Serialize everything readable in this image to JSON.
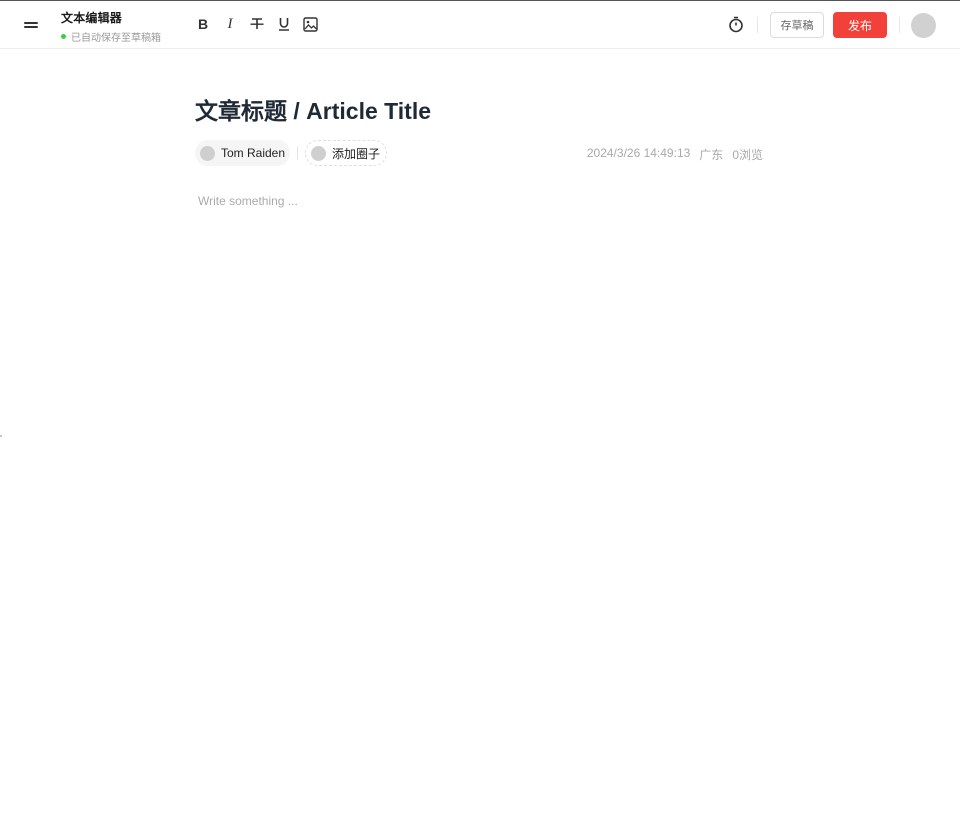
{
  "header": {
    "app_title": "文本编辑器",
    "save_status": "已自动保存至草稿箱",
    "status_color": "#3ecf3e",
    "toolbar": [
      {
        "name": "bold",
        "glyph": "B"
      },
      {
        "name": "italic",
        "glyph": "I"
      },
      {
        "name": "strikethrough",
        "icon": "strikethrough-icon"
      },
      {
        "name": "underline",
        "glyph": "U"
      },
      {
        "name": "image",
        "icon": "image-icon"
      }
    ],
    "timer_icon": "timer-icon",
    "draft_label": "存草稿",
    "publish_label": "发布",
    "publish_color": "#f2403a"
  },
  "article": {
    "title": "文章标题 / Article Title",
    "author": "Tom Raiden",
    "add_circle": "添加圈子",
    "datetime": "2024/3/26 14:49:13",
    "location": "广东",
    "views": "0浏览",
    "placeholder": "Write something ..."
  }
}
